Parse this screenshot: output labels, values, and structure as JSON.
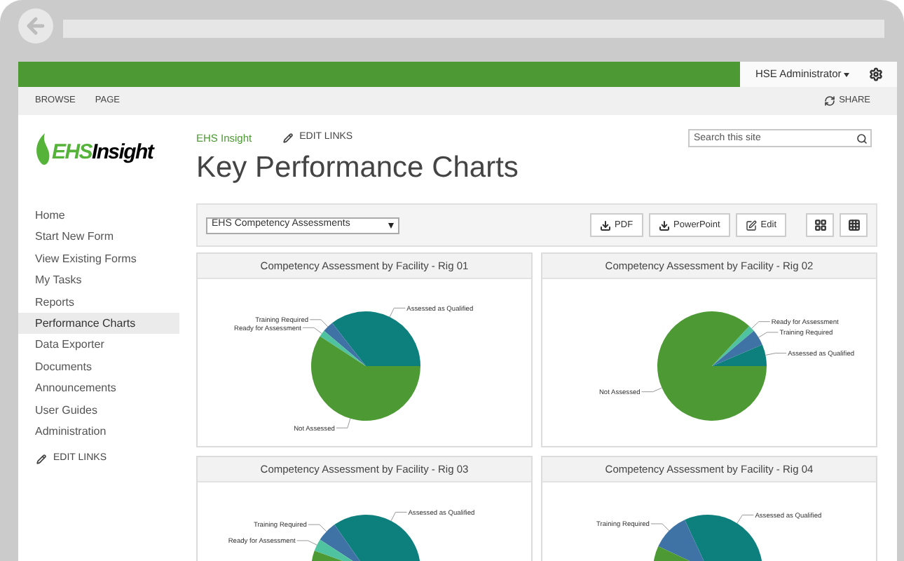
{
  "topbar": {
    "user": "HSE Administrator"
  },
  "ribbon": {
    "tabs": [
      "BROWSE",
      "PAGE"
    ],
    "share": "SHARE"
  },
  "logo": {
    "part_1": "EHS",
    "part_2": "Insight"
  },
  "breadcrumb": {
    "site": "EHS Insight",
    "edit_links": "EDIT LINKS"
  },
  "search": {
    "placeholder": "Search this site"
  },
  "title": "Key Performance Charts",
  "nav": {
    "items": [
      {
        "label": "Home",
        "selected": false
      },
      {
        "label": "Start New Form",
        "selected": false
      },
      {
        "label": "View Existing Forms",
        "selected": false
      },
      {
        "label": "My Tasks",
        "selected": false
      },
      {
        "label": "Reports",
        "selected": false
      },
      {
        "label": "Performance Charts",
        "selected": true
      },
      {
        "label": "Data Exporter",
        "selected": false
      },
      {
        "label": "Documents",
        "selected": false
      },
      {
        "label": "Announcements",
        "selected": false
      },
      {
        "label": "User Guides",
        "selected": false
      },
      {
        "label": "Administration",
        "selected": false
      }
    ],
    "edit_links": "EDIT LINKS"
  },
  "toolbar": {
    "select": "EHS Competency Assessments",
    "buttons": [
      {
        "kind": "download",
        "label": "PDF"
      },
      {
        "kind": "download",
        "label": "PowerPoint"
      },
      {
        "kind": "edit",
        "label": "Edit"
      }
    ],
    "view_buttons": [
      {
        "kind": "grid2"
      },
      {
        "kind": "grid3"
      }
    ]
  },
  "charts": [
    {
      "title": "Competency Assessment by Facility - Rig 01",
      "slices": [
        {
          "label": "Assessed as Qualified",
          "color": "#0d7f7c"
        },
        {
          "label": "Training Required",
          "color": "#3f73a6"
        },
        {
          "label": "Ready for Assessment",
          "color": "#4fc2a0"
        },
        {
          "label": "Not Assessed",
          "color": "#4d9a34"
        }
      ]
    },
    {
      "title": "Competency Assessment by Facility - Rig 02",
      "slices": [
        {
          "label": "Ready for Assessment",
          "color": "#4fc2a0"
        },
        {
          "label": "Training Required",
          "color": "#3f73a6"
        },
        {
          "label": "Assessed as Qualified",
          "color": "#0d7f7c"
        },
        {
          "label": "Not Assessed",
          "color": "#4d9a34"
        }
      ]
    },
    {
      "title": "Competency Assessment by Facility - Rig 03",
      "slices": [
        {
          "label": "Assessed as Qualified",
          "color": "#0d7f7c"
        },
        {
          "label": "Training Required",
          "color": "#3f73a6"
        },
        {
          "label": "Ready for Assessment",
          "color": "#4fc2a0"
        },
        {
          "color": "#4d9a34"
        }
      ]
    },
    {
      "title": "Competency Assessment by Facility - Rig 04",
      "slices": [
        {
          "label": "Assessed as Qualified",
          "color": "#0d7f7c"
        },
        {
          "label": "Training Required",
          "color": "#3f73a6"
        },
        {
          "color": "#4d9a34"
        }
      ]
    }
  ]
}
